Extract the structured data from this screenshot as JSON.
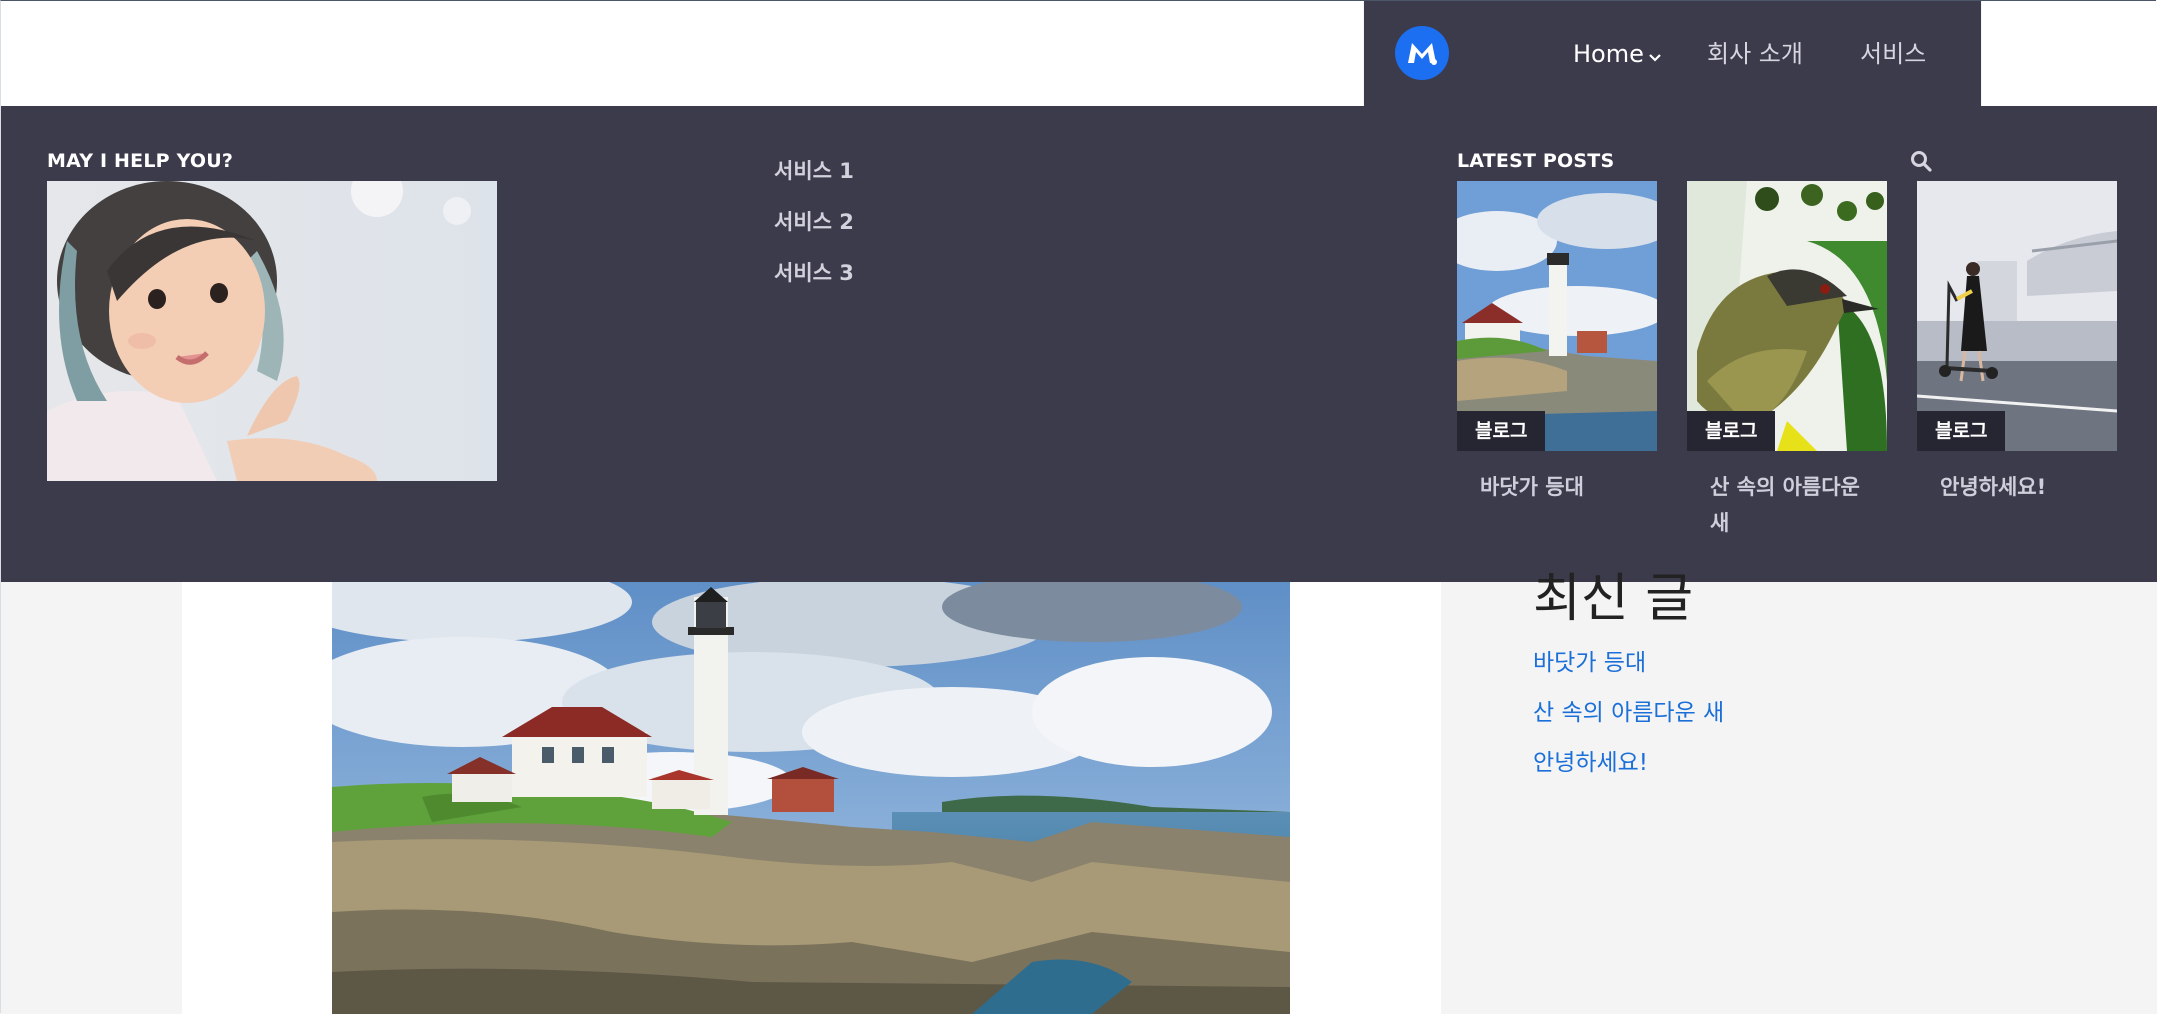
{
  "nav": {
    "items": [
      {
        "label": "Home",
        "active": true,
        "has_dropdown": true
      },
      {
        "label": "회사 소개",
        "active": false,
        "has_dropdown": false
      },
      {
        "label": "서비스",
        "active": false,
        "has_dropdown": false
      }
    ]
  },
  "mega_menu": {
    "help_heading": "MAY I HELP YOU?",
    "services": [
      "서비스 1",
      "서비스 2",
      "서비스 3"
    ],
    "latest_heading": "LATEST POSTS",
    "posts": [
      {
        "category": "블로그",
        "title": "바닷가 등대",
        "image": "lighthouse"
      },
      {
        "category": "블로그",
        "title": "산 속의 아름다운 새",
        "image": "bird"
      },
      {
        "category": "블로그",
        "title": "안녕하세요!",
        "image": "scooter"
      }
    ]
  },
  "sidebar": {
    "title": "최신 글",
    "links": [
      "바닷가 등대",
      "산 속의 아름다운 새",
      "안녕하세요!"
    ]
  },
  "colors": {
    "nav_bg": "#3c3b4b",
    "logo_blue": "#1c6ff0",
    "badge_bg": "#262632",
    "link_blue": "#1a6fd8"
  },
  "icons": [
    "logo-icon",
    "chevron-down-icon",
    "search-icon"
  ]
}
